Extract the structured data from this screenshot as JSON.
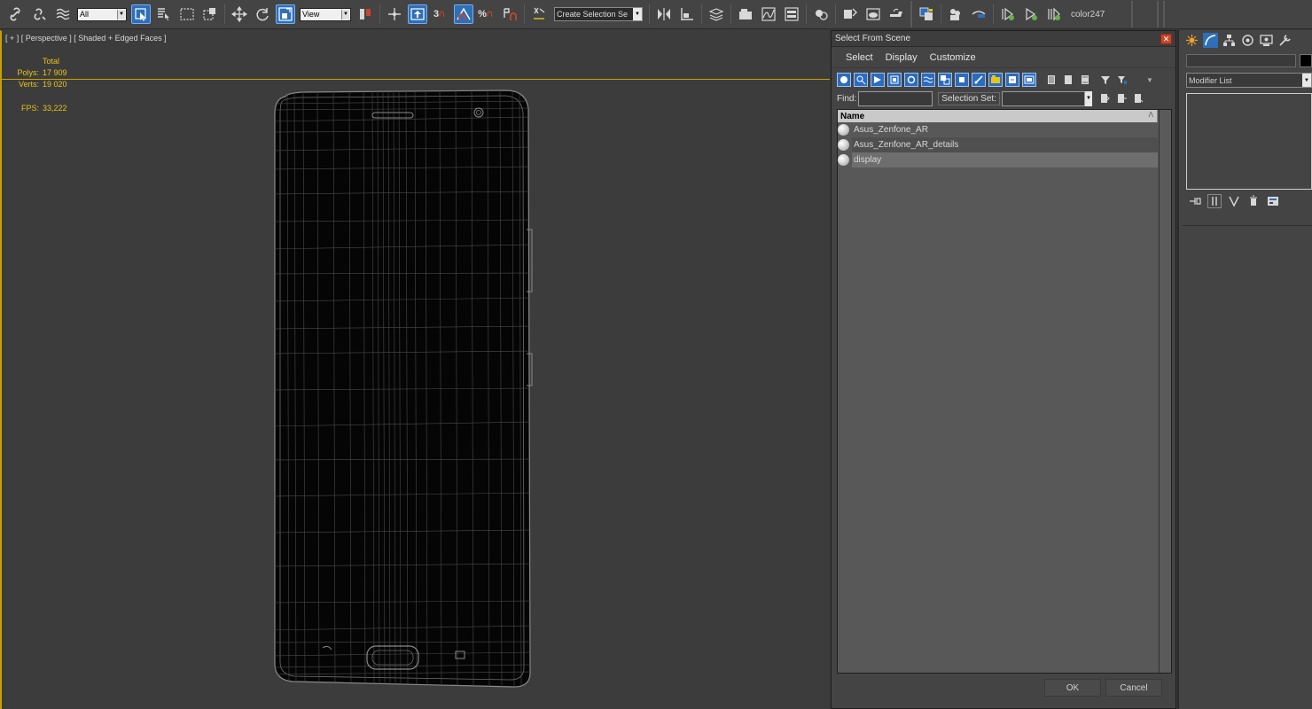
{
  "toolbar": {
    "selection_filter": "All",
    "ref_coord": "View",
    "named_selection_placeholder": "Create Selection Se",
    "snap_3": "3",
    "snap_angle_label": "∠",
    "snap_percent": "%",
    "material_label": "color247"
  },
  "viewport": {
    "label": "[ + ] [ Perspective ] [ Shaded + Edged Faces ]",
    "stats": {
      "header": "Total",
      "polys_label": "Polys:",
      "polys_value": "17 909",
      "verts_label": "Verts:",
      "verts_value": "19 020",
      "fps_label": "FPS:",
      "fps_value": "33,222"
    }
  },
  "dialog": {
    "title": "Select From Scene",
    "close_glyph": "✕",
    "menu": [
      "Select",
      "Display",
      "Customize"
    ],
    "find_label": "Find:",
    "selection_set_label": "Selection Set:",
    "column_name": "Name",
    "sort_glyph": "Λ",
    "objects": [
      {
        "name": "Asus_Zenfone_AR",
        "selected": false
      },
      {
        "name": "Asus_Zenfone_AR_details",
        "selected": false
      },
      {
        "name": "display",
        "selected": true
      }
    ],
    "ok_label": "OK",
    "cancel_label": "Cancel"
  },
  "command_panel": {
    "modifier_list": "Modifier List",
    "object_color": "#000000"
  },
  "colors": {
    "accent_blue": "#2e6fb7",
    "viewport_border": "#c8a000",
    "stats_text": "#e6c41a"
  }
}
